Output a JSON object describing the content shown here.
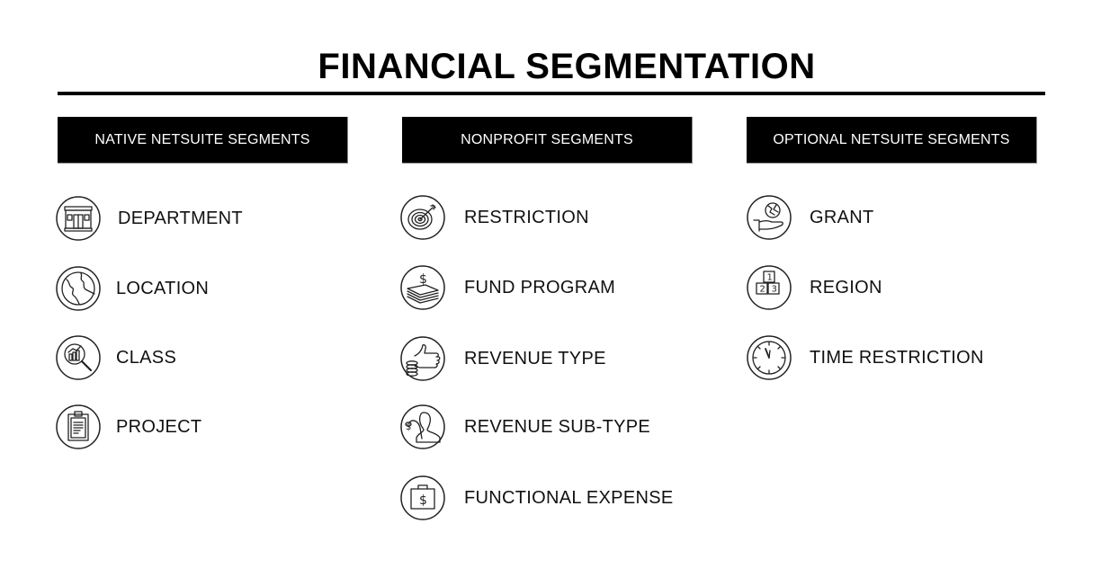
{
  "title": "FINANCIAL SEGMENTATION",
  "columns": [
    {
      "header": "NATIVE NETSUITE SEGMENTS",
      "items": [
        {
          "label": "DEPARTMENT",
          "icon": "storefront-icon"
        },
        {
          "label": "LOCATION",
          "icon": "globe-icon"
        },
        {
          "label": "CLASS",
          "icon": "magnifier-chart-icon"
        },
        {
          "label": "PROJECT",
          "icon": "clipboard-icon"
        }
      ]
    },
    {
      "header": "NONPROFIT SEGMENTS",
      "items": [
        {
          "label": "RESTRICTION",
          "icon": "target-icon"
        },
        {
          "label": "FUND PROGRAM",
          "icon": "money-stack-icon"
        },
        {
          "label": "REVENUE TYPE",
          "icon": "thumbs-up-coins-icon"
        },
        {
          "label": "REVENUE SUB-TYPE",
          "icon": "person-money-icon"
        },
        {
          "label": "FUNCTIONAL EXPENSE",
          "icon": "briefcase-dollar-icon"
        }
      ]
    },
    {
      "header": "OPTIONAL NETSUITE SEGMENTS",
      "items": [
        {
          "label": "GRANT",
          "icon": "hand-globe-icon"
        },
        {
          "label": "REGION",
          "icon": "numbered-blocks-icon"
        },
        {
          "label": "TIME RESTRICTION",
          "icon": "clock-icon"
        }
      ]
    }
  ],
  "region_icon_numbers": [
    "1",
    "2",
    "3"
  ]
}
